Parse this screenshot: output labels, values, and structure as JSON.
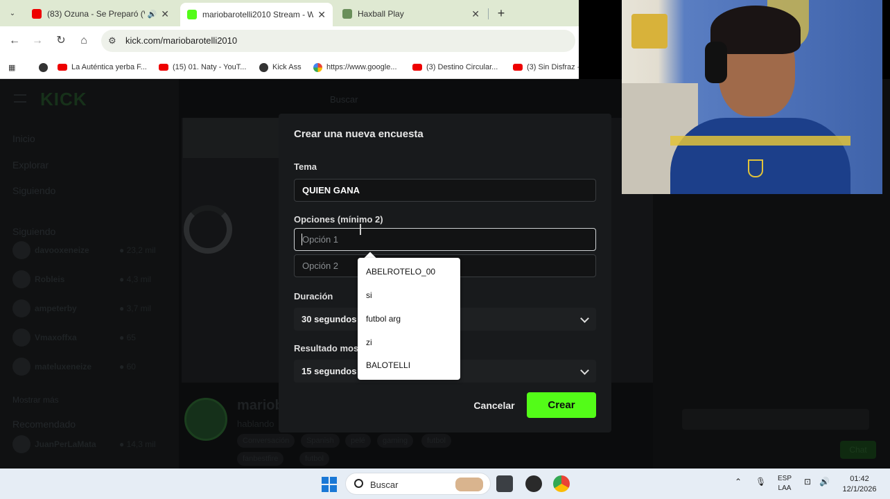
{
  "browser": {
    "tabs": [
      {
        "title": "(83) Ozuna - Se Preparó (Vi",
        "active": false
      },
      {
        "title": "mariobarotelli2010 Stream - W",
        "active": true
      },
      {
        "title": "Haxball Play",
        "active": false
      }
    ],
    "url": "kick.com/mariobarotelli2010",
    "bookmarks": [
      "La Auténtica yerba F...",
      "(15) 01. Naty - YouT...",
      "Kick Ass",
      "https://www.google...",
      "(3) Destino Circular...",
      "(3) Sin Disfraz -"
    ],
    "new_tab_symbol": "+",
    "close_symbol": "✕"
  },
  "kick_bg": {
    "logo": "KICK",
    "nav": [
      "Inicio",
      "Explorar",
      "Siguiendo"
    ],
    "search_placeholder": "Buscar",
    "following_header": "Siguiendo",
    "following": [
      {
        "name": "davooxeneize",
        "count": "● 23,2 mil"
      },
      {
        "name": "Robleis",
        "count": "● 4,3 mil"
      },
      {
        "name": "ampeterby",
        "count": "● 3,7 mil"
      },
      {
        "name": "Vmaxoffxa",
        "count": "● 65"
      },
      {
        "name": "mateluxeneize",
        "count": "● 60"
      }
    ],
    "show_more": "Mostrar más",
    "recommended_header": "Recomendado",
    "recommended": [
      {
        "name": "JuanPerLaMata",
        "count": "● 14,3 mil"
      }
    ],
    "streamer": "mariob",
    "streamer_sub": "hablando",
    "tags": [
      "Conversación",
      "Spanish",
      "pelé",
      "gaming",
      "futbol"
    ],
    "tags_row2": [
      "fanbestfire",
      "futbol"
    ]
  },
  "modal": {
    "title": "Crear una nueva encuesta",
    "topic_label": "Tema",
    "topic_value": "QUIEN GANA",
    "options_label": "Opciones (mínimo 2)",
    "option1_placeholder": "Opción 1",
    "option2_placeholder": "Opción 2",
    "duration_label": "Duración",
    "duration_value": "30 segundos",
    "results_label": "Resultado mos",
    "results_value": "15 segundos",
    "cancel": "Cancelar",
    "create": "Crear"
  },
  "autocomplete": [
    "ABELROTELO_00",
    "si",
    "futbol arg",
    "zi",
    "BALOTELLI"
  ],
  "taskbar": {
    "search_label": "Buscar",
    "lang_top": "ESP",
    "lang_bottom": "LAA",
    "time": "01:42",
    "date": "12/1/2026"
  },
  "colors": {
    "kick_green": "#53fc18",
    "modal_bg": "#181a1c",
    "tabbar": "#dfe9d2"
  }
}
